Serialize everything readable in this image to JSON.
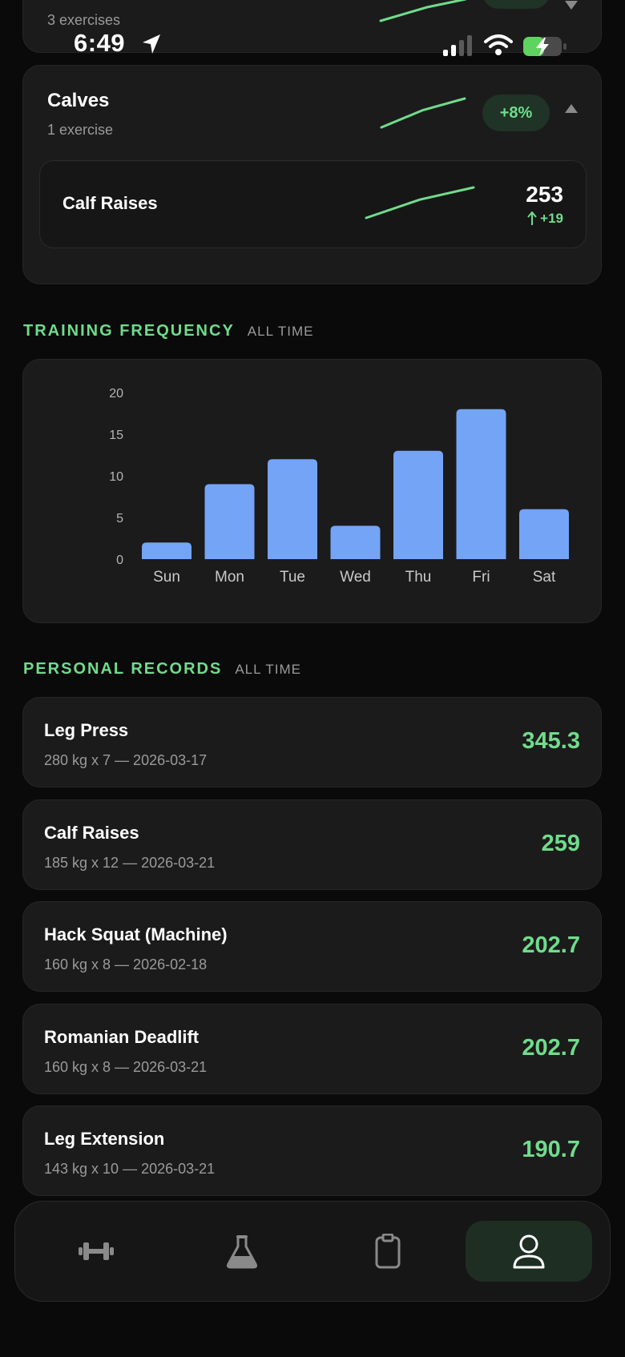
{
  "status_bar": {
    "time": "6:49"
  },
  "top_group": {
    "subtitle": "3 exercises"
  },
  "calves_group": {
    "title": "Calves",
    "subtitle": "1 exercise",
    "change": "+8%",
    "trend": [
      0,
      0.6,
      1
    ],
    "exercise": {
      "name": "Calf Raises",
      "value": "253",
      "delta": "+19",
      "trend": [
        0,
        0.6,
        1
      ]
    }
  },
  "training_frequency": {
    "title": "TRAINING FREQUENCY",
    "tag": "ALL TIME"
  },
  "chart_data": {
    "type": "bar",
    "categories": [
      "Sun",
      "Mon",
      "Tue",
      "Wed",
      "Thu",
      "Fri",
      "Sat"
    ],
    "values": [
      2,
      9,
      12,
      4,
      13,
      18,
      6
    ],
    "ylim": [
      0,
      20
    ],
    "yticks": [
      "0",
      "5",
      "10",
      "15",
      "20"
    ],
    "grid": false,
    "bar_color": "#74a4f6"
  },
  "personal_records": {
    "title": "PERSONAL RECORDS",
    "tag": "ALL TIME",
    "items": [
      {
        "name": "Leg Press",
        "detail": "280 kg x 7 — 2026-03-17",
        "value": "345.3"
      },
      {
        "name": "Calf Raises",
        "detail": "185 kg x 12 — 2026-03-21",
        "value": "259"
      },
      {
        "name": "Hack Squat (Machine)",
        "detail": "160 kg x 8 — 2026-02-18",
        "value": "202.7"
      },
      {
        "name": "Romanian Deadlift",
        "detail": "160 kg x 8 — 2026-03-21",
        "value": "202.7"
      },
      {
        "name": "Leg Extension",
        "detail": "143 kg x 10 — 2026-03-21",
        "value": "190.7"
      }
    ]
  },
  "nav": [
    {
      "icon": "dumbbell-icon",
      "active": false
    },
    {
      "icon": "flask-icon",
      "active": false
    },
    {
      "icon": "clipboard-icon",
      "active": false
    },
    {
      "icon": "profile-icon",
      "active": true
    }
  ],
  "colors": {
    "accent": "#6fdc8c",
    "bar": "#74a4f6",
    "card": "#1b1b1b",
    "background": "#0a0a0a"
  }
}
